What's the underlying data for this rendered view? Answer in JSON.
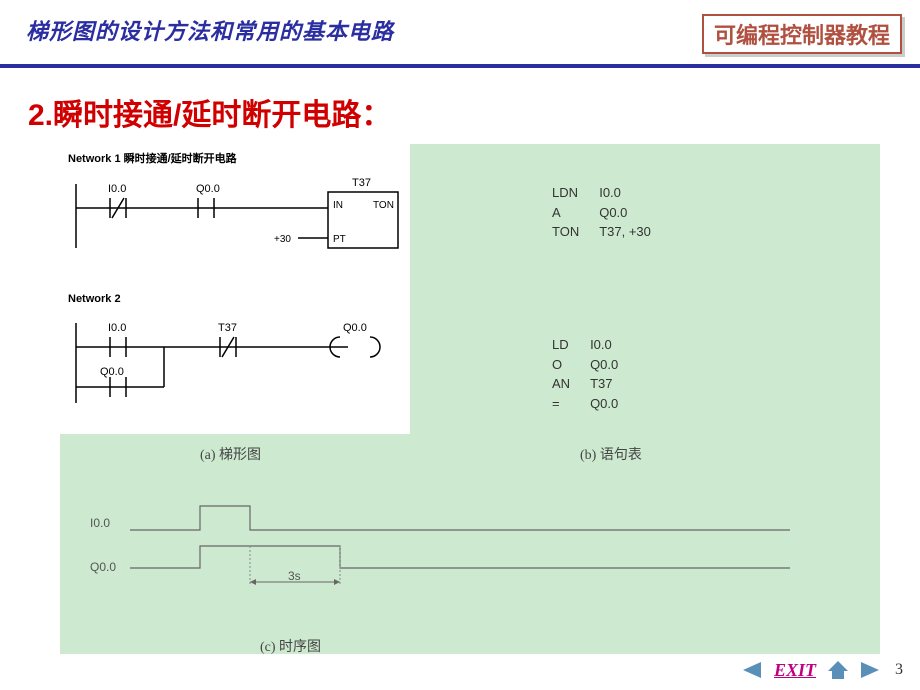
{
  "header": {
    "left": "梯形图的设计方法和常用的基本电路",
    "right": "可编程控制器教程"
  },
  "section_title": "2.瞬时接通/延时断开电路：",
  "ladder": {
    "network1": {
      "title": "Network 1   瞬时接通/延时断开电路",
      "labels": {
        "i00": "I0.0",
        "q00": "Q0.0",
        "t37": "T37",
        "in": "IN",
        "ton": "TON",
        "pt": "PT",
        "preset": "+30"
      }
    },
    "network2": {
      "title": "Network 2",
      "labels": {
        "i00": "I0.0",
        "t37": "T37",
        "q00_coil": "Q0.0",
        "q00_branch": "Q0.0"
      }
    }
  },
  "il": {
    "block1": [
      [
        "LDN",
        "I0.0"
      ],
      [
        "A",
        "Q0.0"
      ],
      [
        "TON",
        "T37, +30"
      ]
    ],
    "block2": [
      [
        "LD",
        "I0.0"
      ],
      [
        "O",
        "Q0.0"
      ],
      [
        "AN",
        "T37"
      ],
      [
        "=",
        "Q0.0"
      ]
    ]
  },
  "captions": {
    "a": "(a)  梯形图",
    "b": "(b)  语句表",
    "c": "(c)  时序图"
  },
  "timing": {
    "row1_label": "I0.0",
    "row2_label": "Q0.0",
    "delay_label": "3s"
  },
  "footer": {
    "exit": "EXIT",
    "page": "3"
  }
}
